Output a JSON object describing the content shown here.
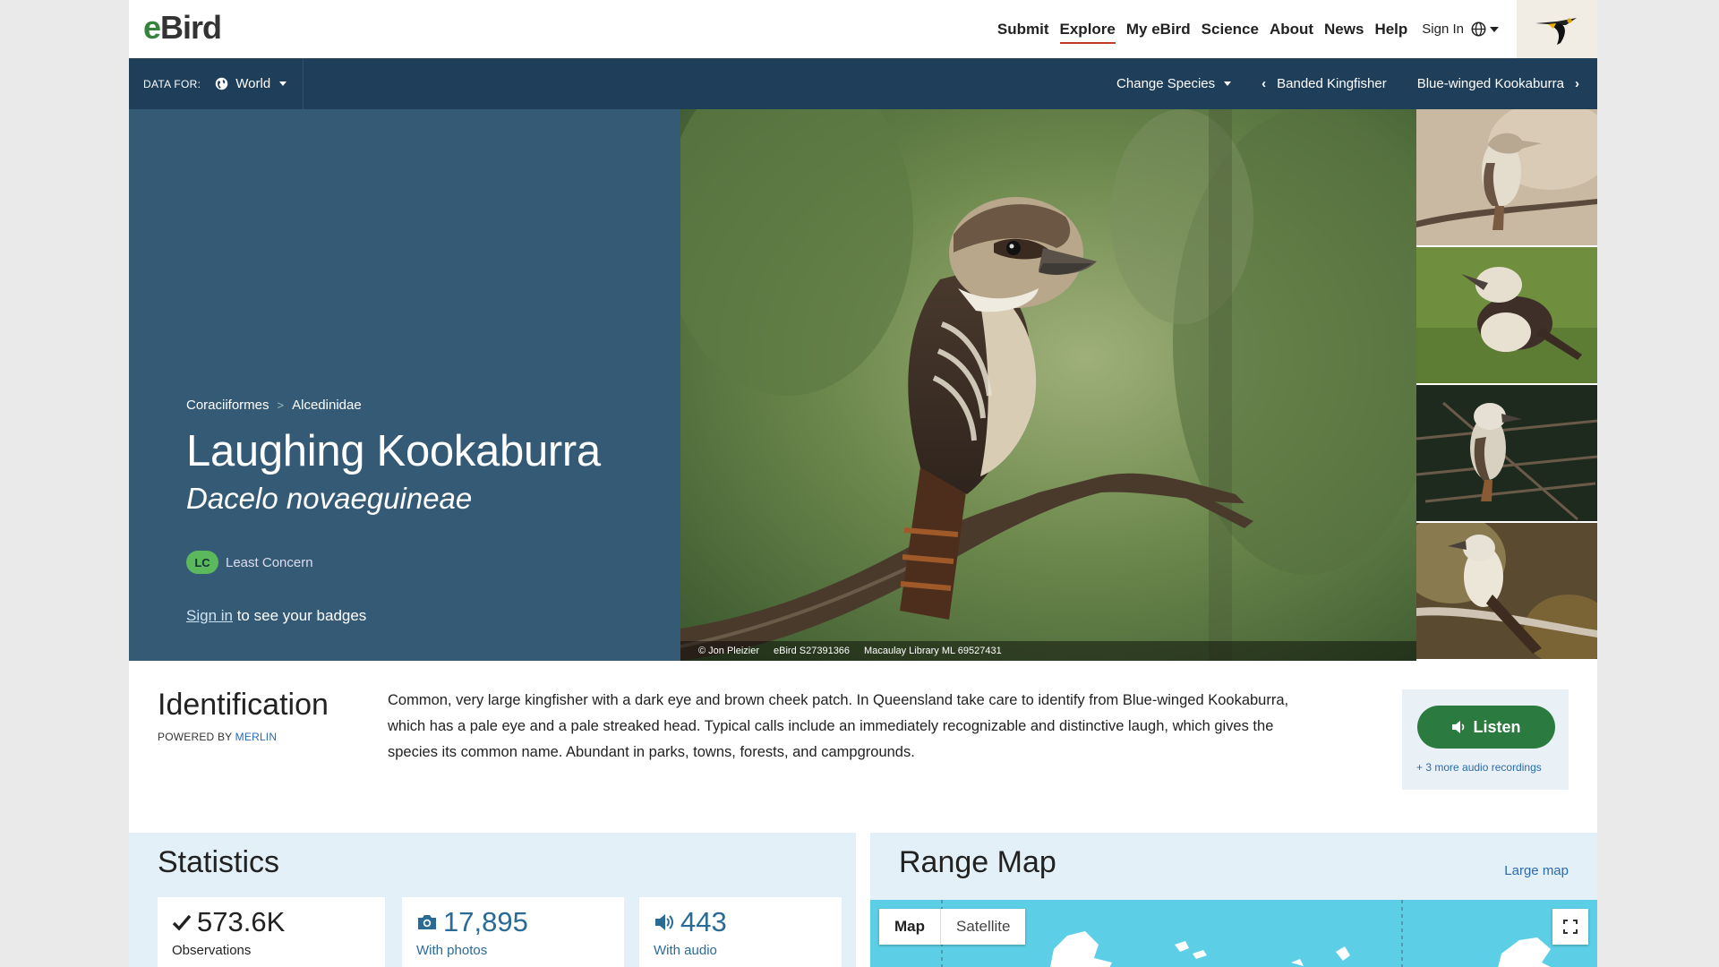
{
  "header": {
    "logo_e": "e",
    "logo_bird": "Bird",
    "nav": [
      {
        "label": "Submit"
      },
      {
        "label": "Explore"
      },
      {
        "label": "My eBird"
      },
      {
        "label": "Science"
      },
      {
        "label": "About"
      },
      {
        "label": "News"
      },
      {
        "label": "Help"
      }
    ],
    "sign_in": "Sign In"
  },
  "databar": {
    "label": "DATA FOR:",
    "region": "World",
    "change_species": "Change Species",
    "prev_species": "Banded Kingfisher",
    "next_species": "Blue-winged Kookaburra"
  },
  "species": {
    "order": "Coraciiformes",
    "family": "Alcedinidae",
    "common_name": "Laughing Kookaburra",
    "scientific_name": "Dacelo novaeguineae",
    "status_code": "LC",
    "status_label": "Least Concern",
    "sign_in_link": "Sign in",
    "badges_text": " to see your badges"
  },
  "photo_credit": {
    "author": "© Jon Pleizier",
    "checklist": "eBird S27391366",
    "library": "Macaulay Library ML 69527431"
  },
  "identification": {
    "title": "Identification",
    "powered_by": "POWERED BY ",
    "powered_link": "MERLIN",
    "description": "Common, very large kingfisher with a dark eye and brown cheek patch. In Queensland take care to identify from Blue-winged Kookaburra, which has a pale eye and a pale streaked head. Typical calls include an immediately recognizable and distinctive laugh, which gives the species its common name. Abundant in parks, towns, forests, and campgrounds.",
    "listen_label": "Listen",
    "more_audio": "+ 3 more audio recordings"
  },
  "statistics": {
    "title": "Statistics",
    "observations_value": "573.6K",
    "observations_label": "Observations",
    "photos_value": "17,895",
    "photos_label": "With photos",
    "audio_value": "443",
    "audio_label": "With audio"
  },
  "range_map": {
    "title": "Range Map",
    "large_map": "Large map",
    "tab_map": "Map",
    "tab_satellite": "Satellite"
  },
  "colors": {
    "header_bar": "#1e3e5a",
    "hero_panel": "#355a76",
    "accent_green": "#2b7a3f",
    "link_blue": "#2a6bb0",
    "stats_bg": "#e4f0f7"
  }
}
